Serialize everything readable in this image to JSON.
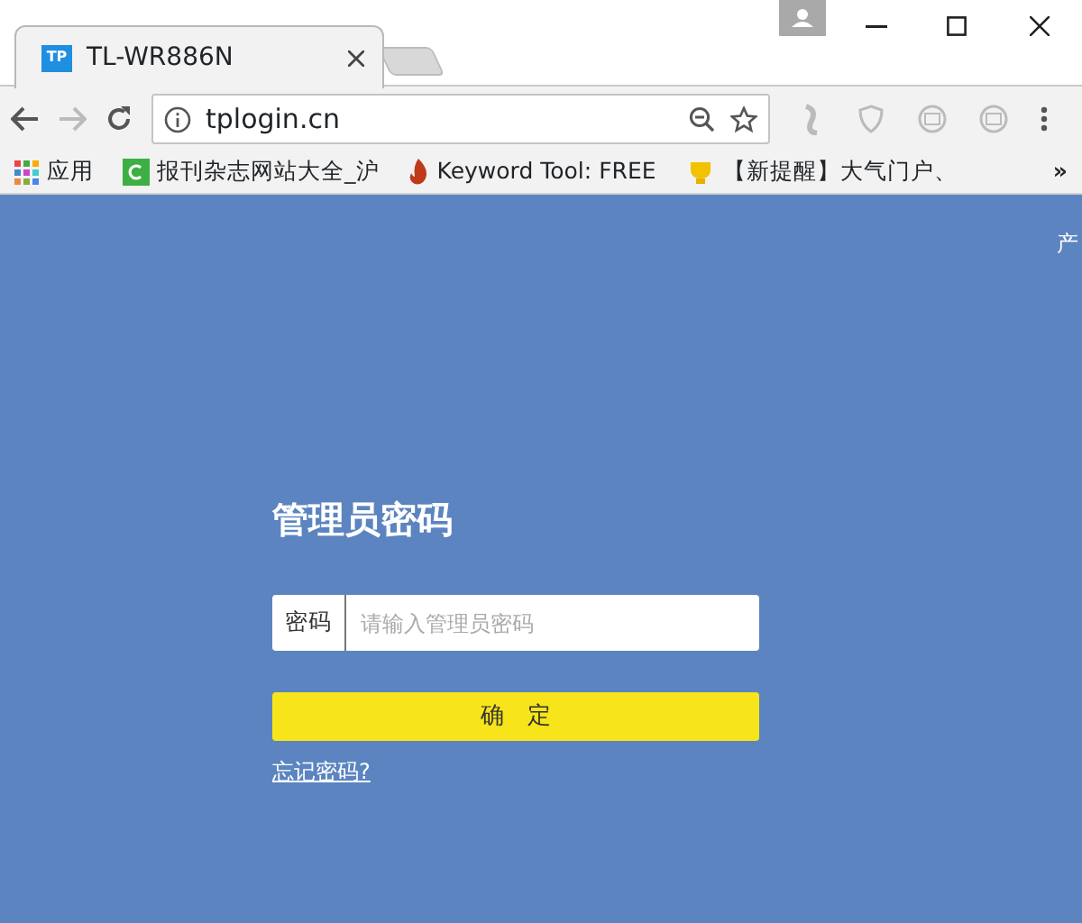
{
  "tabs": [
    {
      "title": "TL-WR886N",
      "favicon": "TP",
      "selected": true
    }
  ],
  "address_bar": {
    "url": "tplogin.cn"
  },
  "bookmarks": [
    {
      "label": "应用",
      "kind": "apps"
    },
    {
      "label": "报刊杂志网站大全_沪",
      "kind": "green"
    },
    {
      "label": "Keyword Tool: FREE",
      "kind": "flame"
    },
    {
      "label": "【新提醒】大气门户、",
      "kind": "trophy"
    }
  ],
  "bookmarks_overflow": "»",
  "page": {
    "corner_text": "产",
    "title": "管理员密码",
    "password_field": {
      "label": "密码",
      "placeholder": "请输入管理员密码"
    },
    "submit_button": "确　定",
    "forgot_link": "忘记密码?"
  }
}
